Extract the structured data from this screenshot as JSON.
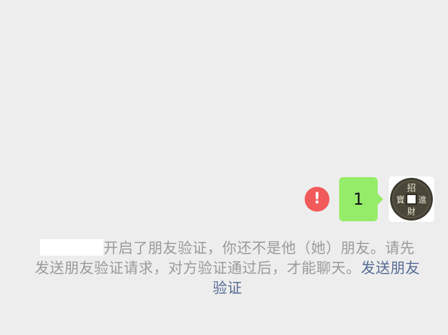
{
  "message": {
    "text": "1",
    "status_icon": "exclamation-icon",
    "bubble_color": "#95ec69",
    "fail_color": "#f25a5a",
    "fail_glyph": "!"
  },
  "avatar": {
    "icon": "ancient-coin-icon",
    "coin_chars": [
      "招",
      "進",
      "寶",
      "財"
    ]
  },
  "notice": {
    "text": "开启了朋友验证，你还不是他（她）朋友。请先发送朋友验证请求，对方验证通过后，才能聊天。",
    "link_text": "发送朋友验证",
    "text_color": "#9a9a9a",
    "link_color": "#576b95"
  }
}
